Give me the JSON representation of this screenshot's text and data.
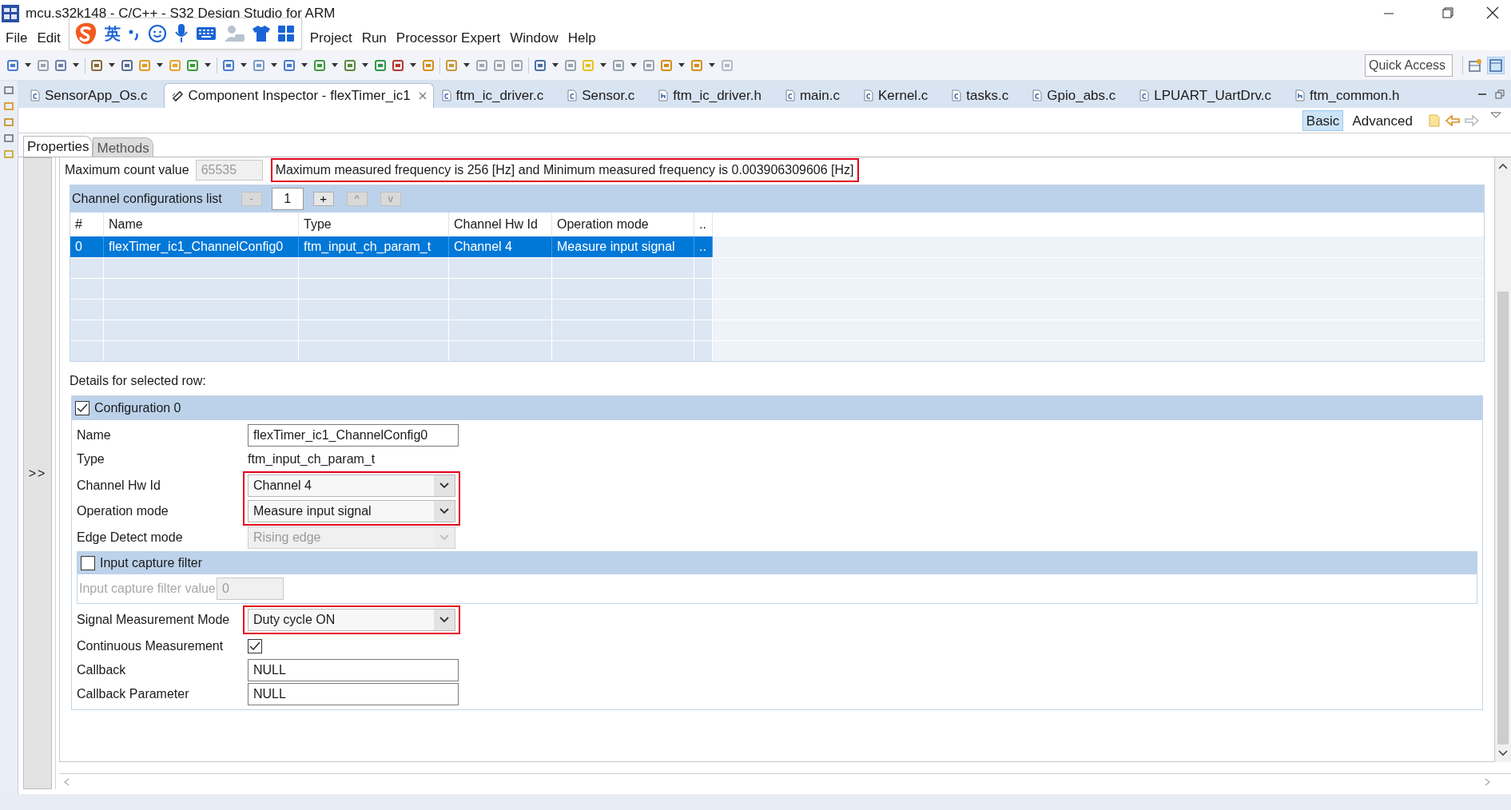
{
  "window": {
    "title": "mcu.s32k148 - C/C++ - S32 Design Studio for ARM"
  },
  "ime_toolbar": {
    "label": "英"
  },
  "menu": [
    "File",
    "Edit",
    "Project",
    "Run",
    "Processor Expert",
    "Window",
    "Help"
  ],
  "quick_access": {
    "placeholder": "Quick Access"
  },
  "editor_tabs": [
    {
      "label": "SensorApp_Os.c",
      "kind": "c",
      "selected": false
    },
    {
      "label": "Component Inspector - flexTimer_ic1",
      "kind": "component",
      "selected": true,
      "closable": true
    },
    {
      "label": "ftm_ic_driver.c",
      "kind": "c",
      "selected": false
    },
    {
      "label": "Sensor.c",
      "kind": "c",
      "selected": false
    },
    {
      "label": "ftm_ic_driver.h",
      "kind": "h",
      "selected": false
    },
    {
      "label": "main.c",
      "kind": "c",
      "selected": false
    },
    {
      "label": "Kernel.c",
      "kind": "c",
      "selected": false
    },
    {
      "label": "tasks.c",
      "kind": "c",
      "selected": false
    },
    {
      "label": "Gpio_abs.c",
      "kind": "c",
      "selected": false
    },
    {
      "label": "LPUART_UartDrv.c",
      "kind": "c",
      "selected": false
    },
    {
      "label": "ftm_common.h",
      "kind": "h",
      "selected": false
    }
  ],
  "view_modes": [
    {
      "label": "Basic",
      "selected": true
    },
    {
      "label": "Advanced",
      "selected": false
    }
  ],
  "inspector_tabs": [
    {
      "label": "Properties",
      "selected": true
    },
    {
      "label": "Methods",
      "selected": false
    }
  ],
  "collapse_toggle": ">>",
  "max_count": {
    "label": "Maximum count value",
    "value": "65535",
    "disabled": true
  },
  "frequency_note": {
    "text": "Maximum measured frequency is 256 [Hz] and Minimum measured frequency is 0.003906309606 [Hz]",
    "highlighted": true
  },
  "channel_list": {
    "label": "Channel configurations list",
    "count": "1",
    "buttons": [
      {
        "label": "-",
        "disabled": true
      },
      {
        "label": "+",
        "disabled": false
      },
      {
        "label": "^",
        "disabled": true
      },
      {
        "label": "v",
        "disabled": true
      }
    ],
    "columns": [
      "#",
      "Name",
      "Type",
      "Channel Hw Id",
      "Operation mode",
      ".."
    ],
    "rows": [
      {
        "cells": [
          "0",
          "flexTimer_ic1_ChannelConfig0",
          "ftm_input_ch_param_t",
          "Channel 4",
          "Measure input signal",
          ".."
        ],
        "selected": true
      }
    ]
  },
  "details": {
    "heading": "Details for selected row:",
    "configuration": {
      "label": "Configuration 0",
      "checked": true
    },
    "fields": [
      {
        "kind": "text",
        "label": "Name",
        "value": "flexTimer_ic1_ChannelConfig0"
      },
      {
        "kind": "static",
        "label": "Type",
        "value": "ftm_input_ch_param_t"
      },
      {
        "kind": "dropdown",
        "label": "Channel Hw Id",
        "value": "Channel 4",
        "disabled": false,
        "highlighted": true
      },
      {
        "kind": "dropdown",
        "label": "Operation mode",
        "value": "Measure input signal",
        "disabled": false,
        "highlighted": true
      },
      {
        "kind": "dropdown",
        "label": "Edge Detect mode",
        "value": "Rising edge",
        "disabled": true,
        "highlighted": false
      },
      {
        "kind": "section",
        "label": "Input capture filter",
        "checked": false,
        "fields": [
          {
            "kind": "text",
            "label": "Input capture filter value",
            "value": "0",
            "disabled": true
          }
        ]
      },
      {
        "kind": "dropdown",
        "label": "Signal Measurement Mode",
        "value": "Duty cycle ON",
        "disabled": false,
        "highlighted": true
      },
      {
        "kind": "checkbox",
        "label": "Continuous Measurement",
        "checked": true
      },
      {
        "kind": "text",
        "label": "Callback",
        "value": "NULL"
      },
      {
        "kind": "text",
        "label": "Callback Parameter",
        "value": "NULL"
      }
    ]
  }
}
